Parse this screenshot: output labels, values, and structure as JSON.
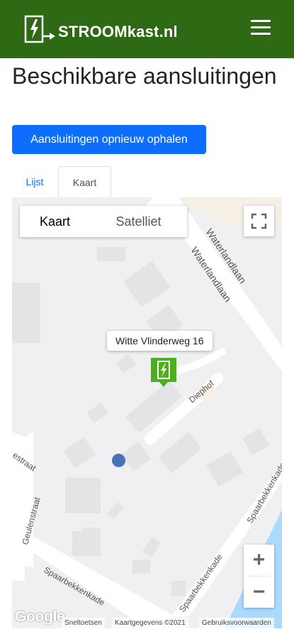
{
  "navbar": {
    "brand": "STROOMkast.nl",
    "brand_color": "#2e6a14",
    "menu_icon": "hamburger-icon"
  },
  "page": {
    "title": "Beschikbare aansluitingen"
  },
  "actions": {
    "reload_label": "Aansluitingen opnieuw ophalen"
  },
  "tabs": [
    {
      "label": "Lijst",
      "active": false
    },
    {
      "label": "Kaart",
      "active": true
    }
  ],
  "map": {
    "map_type_buttons": {
      "map": "Kaart",
      "satellite": "Satelliet"
    },
    "street_labels": {
      "waterlandlaan_1": "Waterlandlaan",
      "waterlandlaan_2": "Waterlandlaan",
      "diephof": "Diephof",
      "estraat": "estraat",
      "geulenstraat": "Geulenstraat",
      "spaarbekkenkade_1": "Spaarbekkenkade",
      "spaarbekkenkade_2": "Spaarbekkenkade",
      "spaarbekkenkade_3": "Spaarbekkenkade"
    },
    "info_window": "Witte Vlinderweg 16",
    "zoom_in": "+",
    "zoom_out": "−",
    "logo": "Google",
    "attribution": {
      "shortcuts": "Sneltoetsen",
      "data": "Kaartgegevens ©2021",
      "terms": "Gebruiksvoorwaarden"
    },
    "marker_color": "#4caf1e",
    "location_dot_color": "#4a72b8",
    "water_color": "#aadaff"
  }
}
